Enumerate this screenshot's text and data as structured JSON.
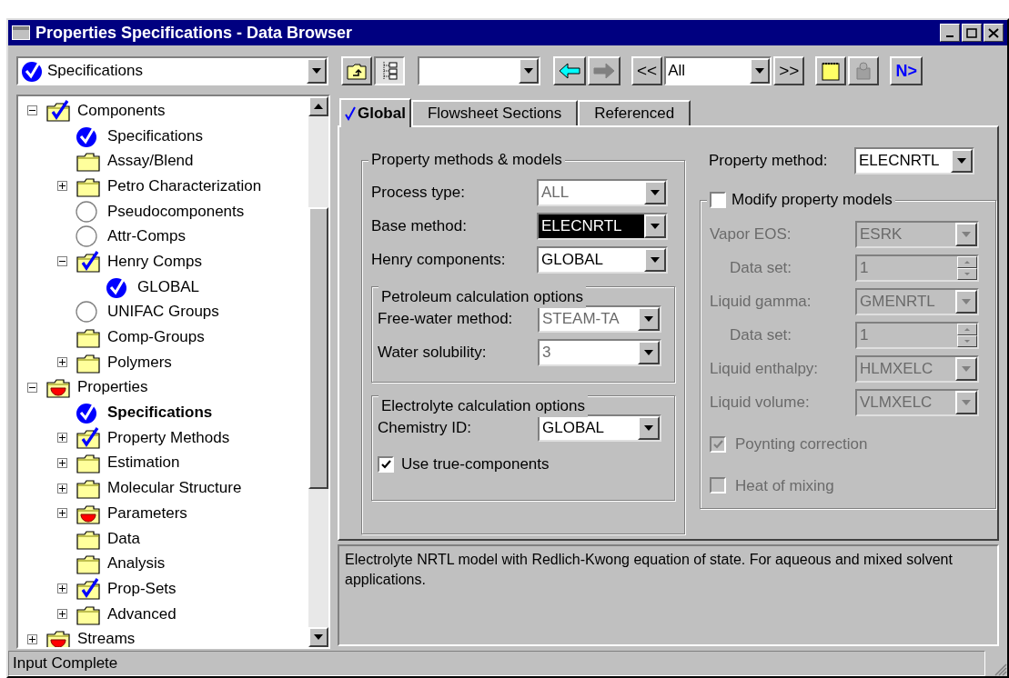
{
  "window": {
    "title": "Properties Specifications - Data Browser"
  },
  "toolbar": {
    "location": "Specifications",
    "view_buttons": [
      {
        "kind": "up-folder",
        "pressed": false
      },
      {
        "kind": "tree",
        "pressed": true
      }
    ],
    "nav_buttons": [
      {
        "kind": "back",
        "disabled": false
      },
      {
        "kind": "forward",
        "disabled": true
      }
    ],
    "prev": "<<",
    "filter": "All",
    "next_page": ">>",
    "tool_buttons": [
      {
        "kind": "notes",
        "disabled": false
      },
      {
        "kind": "stamp",
        "disabled": true
      }
    ],
    "next": "N>"
  },
  "tree": [
    {
      "label": "Components",
      "kind": "folder-check",
      "expanded": true,
      "selected": false,
      "children": [
        {
          "label": "Specifications",
          "kind": "check-circle",
          "selected": false
        },
        {
          "label": "Assay/Blend",
          "kind": "folder",
          "selected": false
        },
        {
          "label": "Petro Characterization",
          "kind": "folder",
          "expanded": false,
          "selected": false
        },
        {
          "label": "Pseudocomponents",
          "kind": "circle",
          "selected": false
        },
        {
          "label": "Attr-Comps",
          "kind": "circle",
          "selected": false
        },
        {
          "label": "Henry Comps",
          "kind": "folder-check",
          "expanded": true,
          "selected": false,
          "children": [
            {
              "label": "GLOBAL",
              "kind": "check-circle",
              "selected": false
            }
          ]
        },
        {
          "label": "UNIFAC Groups",
          "kind": "circle",
          "selected": false
        },
        {
          "label": "Comp-Groups",
          "kind": "folder",
          "selected": false
        },
        {
          "label": "Polymers",
          "kind": "folder",
          "expanded": false,
          "selected": false
        }
      ]
    },
    {
      "label": "Properties",
      "kind": "folder-alert",
      "expanded": true,
      "selected": false,
      "children": [
        {
          "label": "Specifications",
          "kind": "check-circle",
          "selected": true
        },
        {
          "label": "Property Methods",
          "kind": "folder-check",
          "expanded": false,
          "selected": false
        },
        {
          "label": "Estimation",
          "kind": "folder",
          "expanded": false,
          "selected": false
        },
        {
          "label": "Molecular Structure",
          "kind": "folder",
          "expanded": false,
          "selected": false
        },
        {
          "label": "Parameters",
          "kind": "folder-alert",
          "expanded": false,
          "selected": false
        },
        {
          "label": "Data",
          "kind": "folder",
          "selected": false
        },
        {
          "label": "Analysis",
          "kind": "folder",
          "selected": false
        },
        {
          "label": "Prop-Sets",
          "kind": "folder-check",
          "expanded": false,
          "selected": false
        },
        {
          "label": "Advanced",
          "kind": "folder",
          "expanded": false,
          "selected": false
        }
      ]
    },
    {
      "label": "Streams",
      "kind": "folder-alert",
      "expanded": false,
      "selected": false
    }
  ],
  "tabs": [
    {
      "label": "Global",
      "complete": true,
      "selected": true
    },
    {
      "label": "Flowsheet Sections",
      "complete": false,
      "selected": false
    },
    {
      "label": "Referenced",
      "complete": false,
      "selected": false
    }
  ],
  "methods_group": {
    "title": "Property methods & models",
    "fields": [
      {
        "label": "Process type:",
        "value": "ALL",
        "disabled": true,
        "focused": false
      },
      {
        "label": "Base method:",
        "value": "ELECNRTL",
        "disabled": false,
        "focused": true
      },
      {
        "label": "Henry components:",
        "value": "GLOBAL",
        "disabled": false,
        "focused": false
      }
    ]
  },
  "petroleum_group": {
    "title": "Petroleum calculation options",
    "fields": [
      {
        "label": "Free-water method:",
        "value": "STEAM-TA",
        "disabled": true,
        "focused": false
      },
      {
        "label": "Water solubility:",
        "value": "3",
        "disabled": true,
        "focused": false
      }
    ]
  },
  "electrolyte_group": {
    "title": "Electrolyte calculation options",
    "fields": [
      {
        "label": "Chemistry ID:",
        "value": "GLOBAL",
        "disabled": false,
        "focused": false
      }
    ],
    "checkbox": {
      "label": "Use true-components",
      "checked": true
    }
  },
  "property_method": {
    "label": "Property method:",
    "value": "ELECNRTL",
    "disabled": false,
    "focused": false
  },
  "modify_group": {
    "label": "Modify property models",
    "checked": false,
    "fields": [
      {
        "label": "Vapor EOS:",
        "value": "ESRK",
        "kind": "combo"
      },
      {
        "label": "Data set:",
        "value": "1",
        "kind": "spin"
      },
      {
        "label": "Liquid gamma:",
        "value": "GMENRTL",
        "kind": "combo"
      },
      {
        "label": "Data set:",
        "value": "1",
        "kind": "spin"
      },
      {
        "label": "Liquid enthalpy:",
        "value": "HLMXELC",
        "kind": "combo"
      },
      {
        "label": "Liquid volume:",
        "value": "VLMXELC",
        "kind": "combo"
      }
    ],
    "options": [
      {
        "label": "Poynting correction",
        "checked": true
      },
      {
        "label": "Heat of mixing",
        "checked": false
      }
    ]
  },
  "description": "Electrolyte NRTL model with Redlich-Kwong equation of state. For aqueous and mixed solvent applications.",
  "status_bar": "Input Complete"
}
